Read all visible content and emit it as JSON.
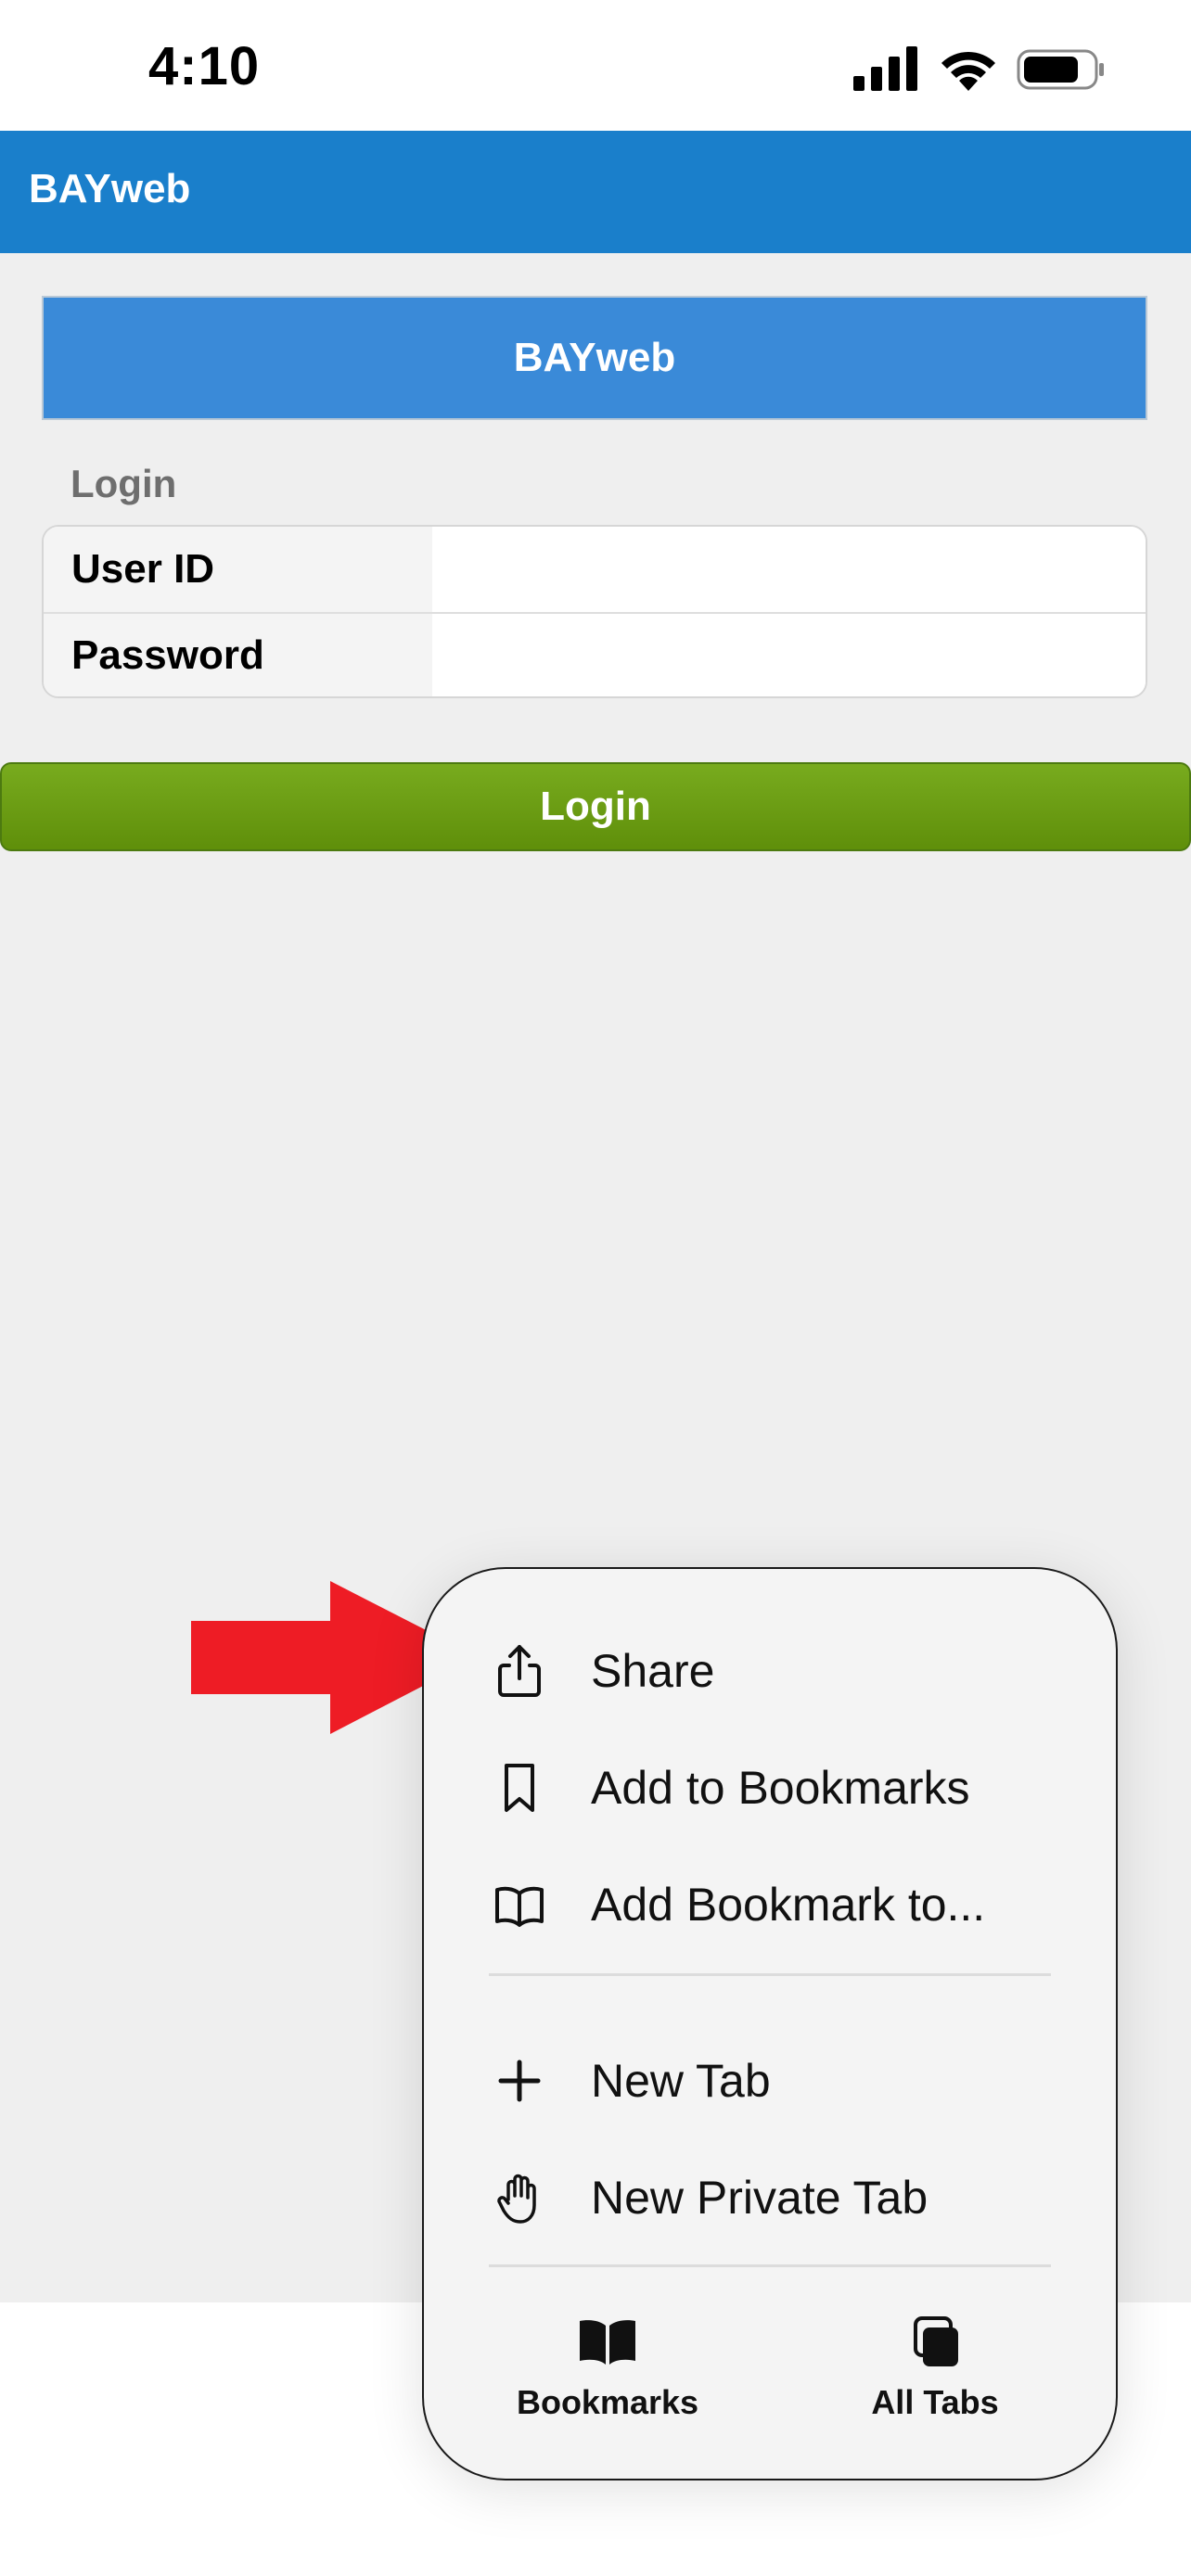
{
  "status_bar": {
    "time": "4:10"
  },
  "app": {
    "header_title": "BAYweb",
    "banner_title": "BAYweb"
  },
  "login": {
    "section_label": "Login",
    "user_id_label": "User ID",
    "user_id_value": "",
    "password_label": "Password",
    "password_value": "",
    "button_label": "Login"
  },
  "context_menu": {
    "items": [
      {
        "label": "Share",
        "icon": "share-icon"
      },
      {
        "label": "Add to Bookmarks",
        "icon": "bookmark-icon"
      },
      {
        "label": "Add Bookmark to...",
        "icon": "book-open-icon"
      },
      {
        "label": "New Tab",
        "icon": "plus-icon"
      },
      {
        "label": "New Private Tab",
        "icon": "hand-icon"
      }
    ],
    "bottom": [
      {
        "label": "Bookmarks",
        "icon": "book-filled-icon"
      },
      {
        "label": "All Tabs",
        "icon": "tabs-icon"
      }
    ]
  },
  "colors": {
    "header_blue": "#1a7fcb",
    "banner_blue": "#3a8ad8",
    "login_green": "#6a9a12",
    "arrow_red": "#ee1c25"
  }
}
